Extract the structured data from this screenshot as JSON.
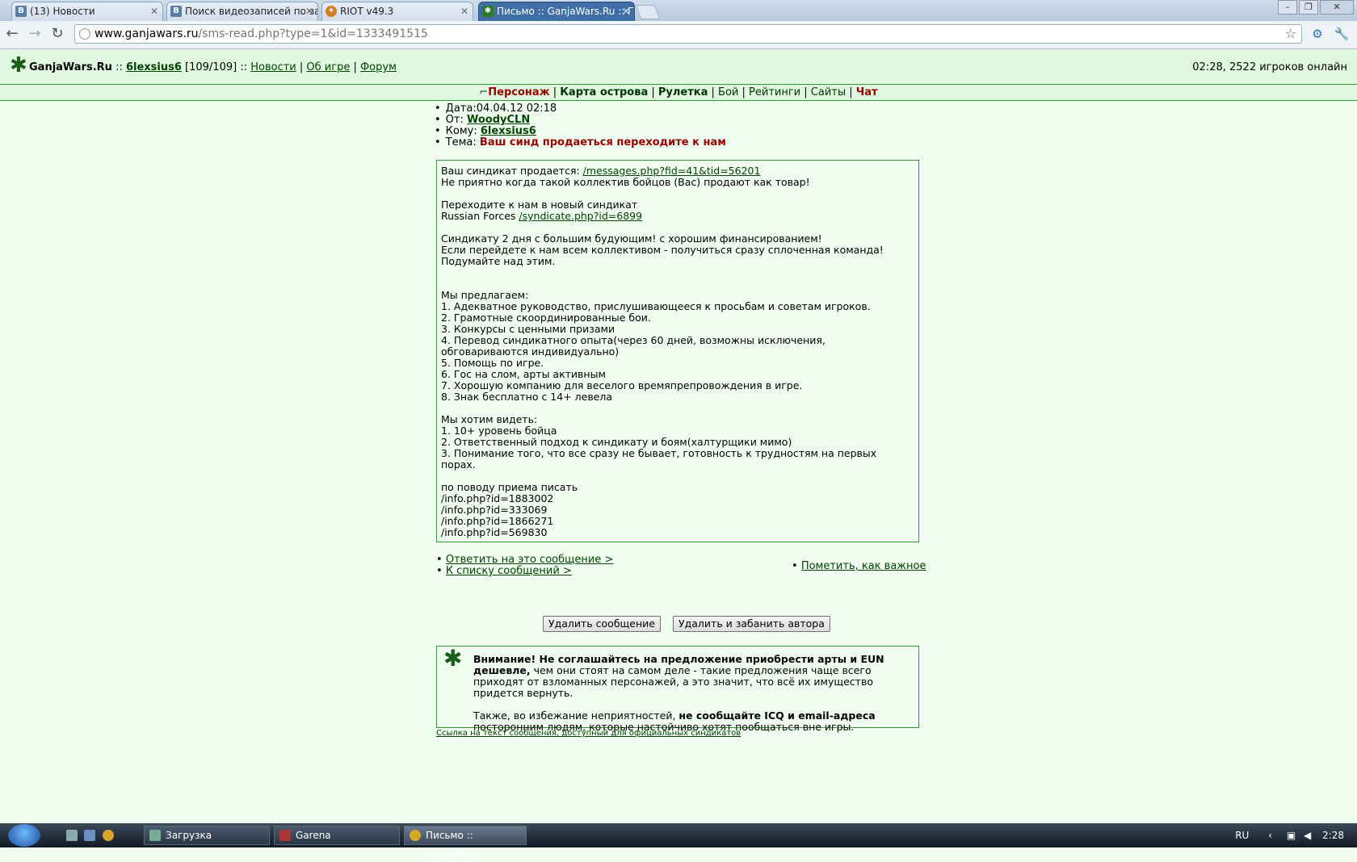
{
  "browser": {
    "tabs": [
      {
        "title": "(13) Новости",
        "icon": "vk-icon",
        "icon_color": "#5a7fa6"
      },
      {
        "title": "Поиск видеозаписей по за",
        "icon": "vk-icon",
        "icon_color": "#5a7fa6"
      },
      {
        "title": "RIOT v49.3",
        "icon": "riot-icon",
        "icon_color": "#d08020"
      },
      {
        "title": "Письмо :: GanjaWars.Ru :: Г",
        "icon": "ganjawars-leaf-icon",
        "icon_color": "#2a7a2a"
      }
    ],
    "url_host": "www.ganjawars.ru",
    "url_path": "/sms-read.php?type=1&id=1333491515"
  },
  "header": {
    "site_name": "GanjaWars.Ru",
    "sep1": " :: ",
    "username": "6lexsius6",
    "level": " [109/109] ",
    "sep2": ":: ",
    "news": "Новости",
    "about": "Об игре",
    "forum": "Форум",
    "online": "02:28, 2522 игроков онлайн"
  },
  "nav": {
    "character": "Персонаж",
    "island_map": "Карта острова",
    "roulette": "Рулетка",
    "battle": "Бой",
    "ratings": "Рейтинги",
    "sites": "Сайты",
    "chat": "Чат"
  },
  "message": {
    "date_label": "Дата:",
    "date": "04.04.12 02:18",
    "from_label": "От: ",
    "from": "WoodyCLN",
    "to_label": "Кому: ",
    "to": "6lexsius6",
    "subject_label": "Тема: ",
    "subject": "Ваш синд продаеться переходите к нам",
    "line1_text": "Ваш синдикат продается: ",
    "line1_link": "/messages.php?fid=41&tid=56201",
    "line2": "Не приятно когда такой коллектив бойцов (Вас) продают как товар!",
    "line3": "Переходите к нам в новый синдикат",
    "line4_text": "Russian Forces ",
    "line4_link": "/syndicate.php?id=6899",
    "line5": "Синдикату 2 дня с большим будующим! с хорошим финансированием!",
    "line6": "Если перейдете к нам всем коллективом - получиться сразу сплоченная команда!",
    "line7": "Подумайте над этим.",
    "offer_title": "Мы предлагаем:",
    "offer_items": [
      "1. Адекватное руководство, прислушивающееся к просьбам и советам игроков.",
      "2. Грамотные скоординированные бои.",
      "3. Конкурсы с ценными призами",
      "4. Перевод синдикатного опыта(через 60 дней, возможны исключения,",
      "обговариваются индивидуально)",
      "5. Помощь по игре.",
      "6. Гос на слом, арты активным",
      "7. Хорошую компанию для веселого времяпрепровождения в игре.",
      "8. Знак бесплатно с 14+ левела"
    ],
    "want_title": "Мы хотим видеть:",
    "want_items": [
      "1. 10+ уровень бойца",
      "2. Ответственный подход к синдикату и боям(халтурщики мимо)",
      "3. Понимание того, что все сразу не бывает, готовность к трудностям на первых",
      "порах."
    ],
    "contact_title": "по поводу приема писать",
    "contacts": [
      "/info.php?id=1883002",
      "/info.php?id=333069",
      "/info.php?id=1866271",
      "/info.php?id=569830"
    ]
  },
  "actions": {
    "reply": "Ответить на это сообщение >",
    "to_list": "К списку сообщений >",
    "mark_important": "Пометить, как важное",
    "delete": "Удалить сообщение",
    "delete_ban": "Удалить и забанить автора"
  },
  "warning": {
    "bold1": "Внимание! Не соглашайтесь на предложение приобрести арты и EUN дешевле,",
    "text1": " чем они стоят на самом деле - такие предложения чаще всего приходят от взломанных персонажей, а это значит, что всё их имущество придется вернуть.",
    "text2": "Также, во избежание неприятностей, ",
    "bold2": "не сообщайте ICQ и email-адреса",
    "text3": " посторонним людям, которые настойчиво хотят пообщаться вне игры."
  },
  "syndicate_link": "Ссылка на текст сообщения, доступный для официальных синдикатов",
  "taskbar": {
    "items": [
      "Загрузка",
      "Garena",
      "Письмо :: GanjaWar..."
    ],
    "lang": "RU",
    "time": "2:28"
  }
}
